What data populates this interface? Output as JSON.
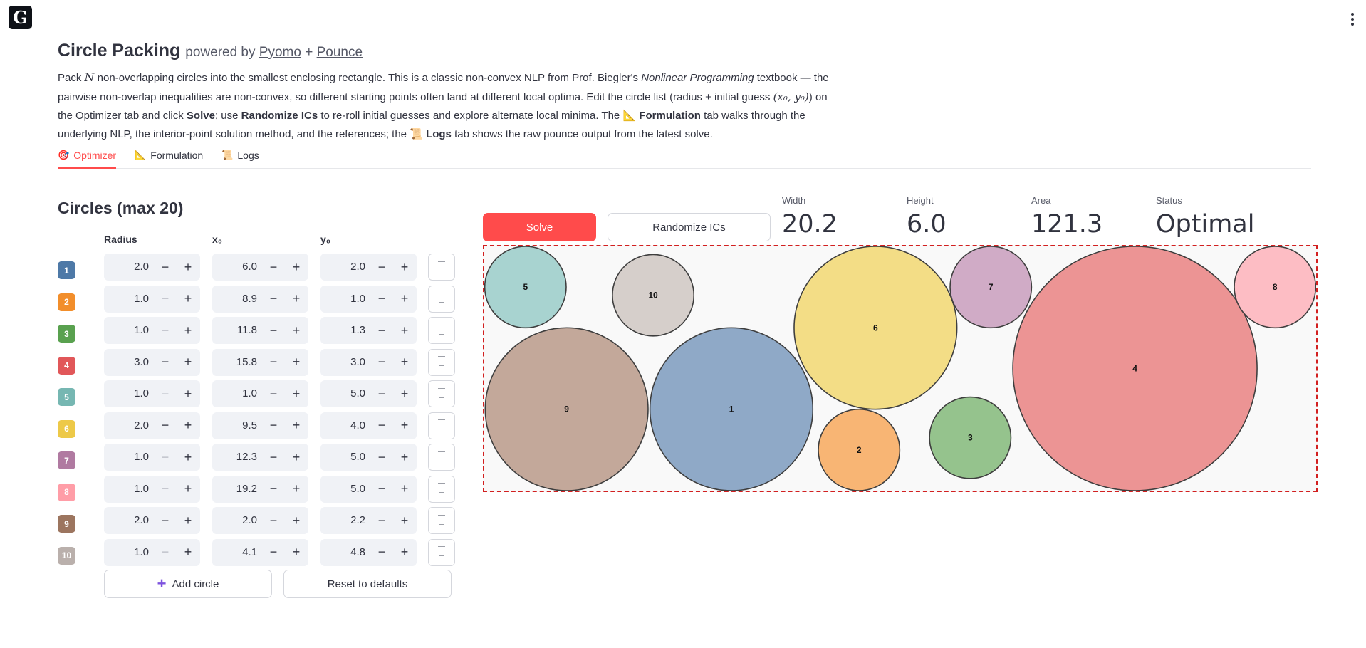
{
  "app": {
    "logo_glyph": "G"
  },
  "header": {
    "title": "Circle Packing",
    "powered_by": "powered by",
    "link1": "Pyomo",
    "plus": "+",
    "link2": "Pounce",
    "desc": {
      "p1": "Pack ",
      "var_n": "N",
      "p2": " non-overlapping circles into the smallest enclosing rectangle. This is a classic non-convex NLP from Prof. Biegler's ",
      "book": "Nonlinear Programming",
      "p3": " textbook — the pairwise non-overlap inequalities are non-convex, so different starting points often land at different local optima. Edit the circle list (radius + initial guess ",
      "math": "(x₀, y₀)",
      "p4": ") on the Optimizer tab and click ",
      "solve": "Solve",
      "p5": "; use ",
      "randomize": "Randomize ICs",
      "p6": " to re-roll initial guesses and explore alternate local minima. The ",
      "formulation_icon": "📐",
      "formulation": "Formulation",
      "p7": " tab walks through the underlying NLP, the interior-point solution method, and the references; the ",
      "logs_icon": "📜",
      "logs": "Logs",
      "p8": " tab shows the raw pounce output from the latest solve."
    }
  },
  "tabs": [
    {
      "icon": "🎯",
      "label": "Optimizer"
    },
    {
      "icon": "📐",
      "label": "Formulation"
    },
    {
      "icon": "📜",
      "label": "Logs"
    }
  ],
  "circles_panel": {
    "title": "Circles (max 20)",
    "headers": {
      "radius": "Radius",
      "x0": "x₀",
      "y0": "y₀"
    },
    "minus": "−",
    "plus": "+",
    "rows": [
      {
        "id": "1",
        "color": "#4e79a7",
        "radius": "2.0",
        "x0": "6.0",
        "y0": "2.0"
      },
      {
        "id": "2",
        "color": "#f28e2b",
        "radius": "1.0",
        "x0": "8.9",
        "y0": "1.0"
      },
      {
        "id": "3",
        "color": "#59a14f",
        "radius": "1.0",
        "x0": "11.8",
        "y0": "1.3"
      },
      {
        "id": "4",
        "color": "#e15759",
        "radius": "3.0",
        "x0": "15.8",
        "y0": "3.0"
      },
      {
        "id": "5",
        "color": "#76b7b2",
        "radius": "1.0",
        "x0": "1.0",
        "y0": "5.0"
      },
      {
        "id": "6",
        "color": "#edc948",
        "radius": "2.0",
        "x0": "9.5",
        "y0": "4.0"
      },
      {
        "id": "7",
        "color": "#b07aa1",
        "radius": "1.0",
        "x0": "12.3",
        "y0": "5.0"
      },
      {
        "id": "8",
        "color": "#ff9da7",
        "radius": "1.0",
        "x0": "19.2",
        "y0": "5.0"
      },
      {
        "id": "9",
        "color": "#9c755f",
        "radius": "2.0",
        "x0": "2.0",
        "y0": "2.2"
      },
      {
        "id": "10",
        "color": "#bab0ac",
        "radius": "1.0",
        "x0": "4.1",
        "y0": "4.8"
      }
    ],
    "add_button": "Add circle",
    "reset_button": "Reset to defaults"
  },
  "actions": {
    "solve": "Solve",
    "randomize": "Randomize ICs"
  },
  "metrics": [
    {
      "label": "Width",
      "value": "20.2"
    },
    {
      "label": "Height",
      "value": "6.0"
    },
    {
      "label": "Area",
      "value": "121.3"
    },
    {
      "label": "Status",
      "value": "Optimal"
    }
  ],
  "chart_data": {
    "type": "scatter",
    "xlim": [
      0,
      20.2
    ],
    "ylim": [
      0,
      6.0
    ],
    "border_color": "#d22020",
    "circles": [
      {
        "label": "1",
        "x": 6.0,
        "y": 2.0,
        "r": 2.0,
        "color": "#8fa9c7"
      },
      {
        "label": "2",
        "x": 9.1,
        "y": 1.0,
        "r": 1.0,
        "color": "#f8b574"
      },
      {
        "label": "3",
        "x": 11.8,
        "y": 1.3,
        "r": 1.0,
        "color": "#95c38d"
      },
      {
        "label": "4",
        "x": 15.8,
        "y": 3.0,
        "r": 3.0,
        "color": "#ec9494"
      },
      {
        "label": "5",
        "x": 1.0,
        "y": 5.0,
        "r": 1.0,
        "color": "#a8d3d0"
      },
      {
        "label": "6",
        "x": 9.5,
        "y": 4.0,
        "r": 2.0,
        "color": "#f3dd86"
      },
      {
        "label": "7",
        "x": 12.3,
        "y": 5.0,
        "r": 1.0,
        "color": "#d0abc6"
      },
      {
        "label": "8",
        "x": 19.2,
        "y": 5.0,
        "r": 1.0,
        "color": "#fdbdc4"
      },
      {
        "label": "9",
        "x": 2.0,
        "y": 2.0,
        "r": 2.0,
        "color": "#c3a89a"
      },
      {
        "label": "10",
        "x": 4.1,
        "y": 4.8,
        "r": 1.0,
        "color": "#d6cfcb"
      }
    ]
  }
}
